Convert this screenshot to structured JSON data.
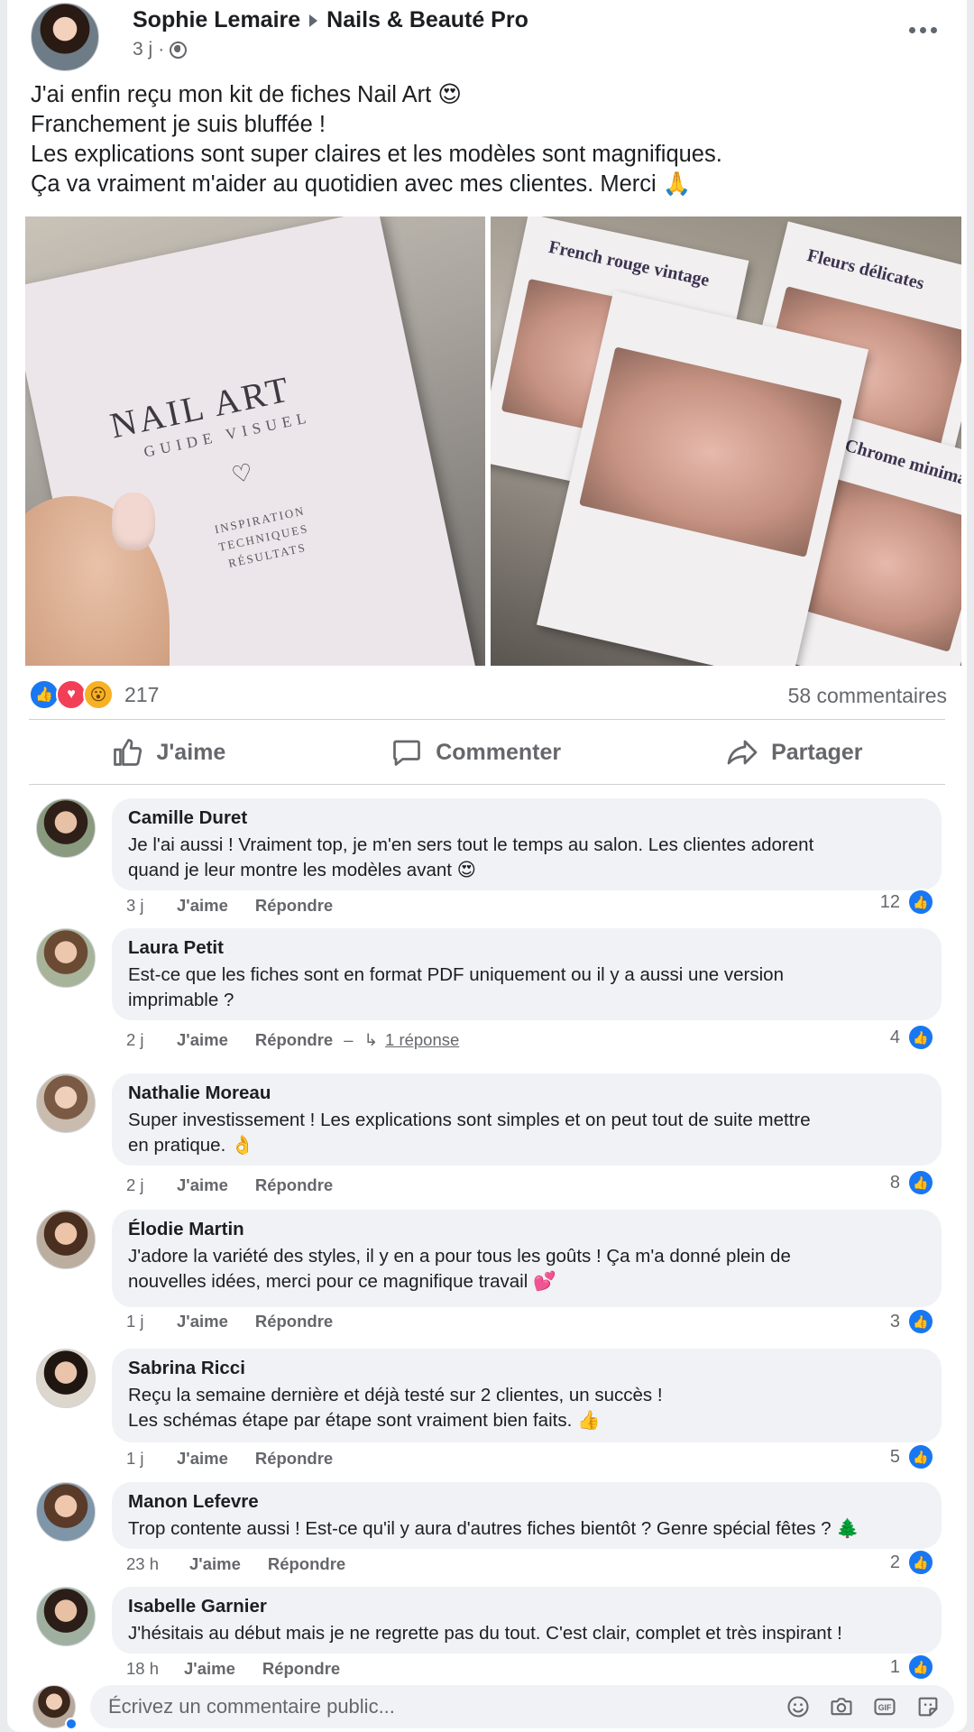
{
  "post": {
    "author": "Sophie Lemaire",
    "group": "Nails & Beauté Pro",
    "time": "3 j",
    "text": [
      "J'ai enfin reçu mon kit de fiches Nail Art 😍",
      "Franchement je suis bluffée !",
      "Les explications sont super claires et les modèles sont magnifiques.",
      "Ça va vraiment m'aider au quotidien avec mes clientes. Merci 🙏"
    ],
    "photo_left": {
      "title": "NAIL ART",
      "subtitle": "GUIDE VISUEL",
      "tagline": [
        "INSPIRATION",
        "TECHNIQUES",
        "RÉSULTATS"
      ]
    },
    "photo_right": {
      "sheets": [
        "French rouge vintage",
        "Fleurs délicates",
        "Chrome minimal"
      ]
    },
    "reaction_count": "217",
    "comment_count": "58 commentaires"
  },
  "actions": {
    "like": "J'aime",
    "comment": "Commenter",
    "share": "Partager"
  },
  "comments": [
    {
      "name": "Camille Duret",
      "lines": [
        "Je l'ai aussi ! Vraiment top, je m'en sers tout le temps au salon. Les clientes adorent",
        "quand je leur montre les modèles avant 😍"
      ],
      "time": "3 j",
      "like": "J'aime",
      "reply": "Répondre",
      "likes": "12"
    },
    {
      "name": "Laura Petit",
      "lines": [
        "Est-ce que les fiches sont en format PDF uniquement ou il y a aussi une version",
        "imprimable ?"
      ],
      "time": "2 j",
      "like": "J'aime",
      "reply": "Répondre",
      "replies": "1 réponse",
      "likes": "4"
    },
    {
      "name": "Nathalie Moreau",
      "lines": [
        "Super investissement !  Les explications sont simples et on peut tout de suite mettre",
        "en pratique. 👌"
      ],
      "time": "2 j",
      "like": "J'aime",
      "reply": "Répondre",
      "likes": "8"
    },
    {
      "name": "Élodie Martin",
      "lines": [
        "J'adore la variété des styles, il y en a pour tous les goûts ! Ça m'a donné plein de",
        "nouvelles idées, merci pour ce magnifique travail 💕"
      ],
      "time": "1 j",
      "like": "J'aime",
      "reply": "Répondre",
      "likes": "3"
    },
    {
      "name": "Sabrina Ricci",
      "lines": [
        "Reçu la semaine dernière et déjà testé sur 2 clientes, un succès !",
        "Les schémas étape par étape sont vraiment bien faits. 👍"
      ],
      "time": "1 j",
      "like": "J'aime",
      "reply": "Répondre",
      "likes": "5"
    },
    {
      "name": "Manon Lefevre",
      "lines": [
        "Trop contente aussi ! Est-ce qu'il y aura d'autres fiches bientôt ? Genre spécial fêtes ? 🌲"
      ],
      "time": "23 h",
      "like": "J'aime",
      "reply": "Répondre",
      "likes": "2"
    },
    {
      "name": "Isabelle Garnier",
      "lines": [
        "J'hésitais au début mais je ne regrette pas du tout. C'est clair, complet et très inspirant !"
      ],
      "time": "18 h",
      "like": "J'aime",
      "reply": "Répondre",
      "likes": "1"
    }
  ],
  "composer": {
    "placeholder": "Écrivez un commentaire public..."
  },
  "colors": {
    "like_blue": "#1877f2",
    "love_red": "#f33e58",
    "wow_yellow": "#f7b125",
    "bubble_bg": "#f0f2f5",
    "muted_text": "#65676b"
  },
  "icons": [
    "more-icon",
    "globe-icon",
    "like-reaction-icon",
    "love-reaction-icon",
    "wow-reaction-icon",
    "thumbs-up-icon",
    "comment-icon",
    "share-icon",
    "emoji-icon",
    "camera-icon",
    "gif-icon",
    "sticker-icon"
  ]
}
